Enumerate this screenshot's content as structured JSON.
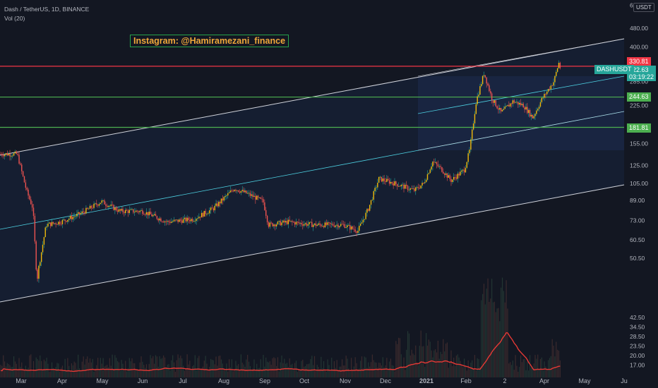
{
  "header": {
    "line1": "Dash / TetherUS, 1D, BINANCE",
    "line2": "Vol (20)"
  },
  "annotation": "Instagram: @Hamiramezani_finance",
  "unit_button": "USDT",
  "symbol_tag": "DASHUSDT",
  "price_tags": {
    "resistance": "330.81",
    "last": "322.63",
    "countdown": "03:19:22",
    "level_1": "244.63",
    "level_2": "181.81"
  },
  "colors": {
    "background": "#131722",
    "up": "#26a69a",
    "down": "#ef5350",
    "hline_red": "#f23645",
    "hline_green": "#4caf50",
    "channel": "#d1d4dc",
    "midline": "#2196f3",
    "volume_ma": "#e53935",
    "gold": "#f0b90b"
  },
  "chart_data": {
    "type": "candlestick",
    "title": "Dash / TetherUS, 1D, BINANCE",
    "y_scale": "log",
    "y_ticks": [
      "600.00",
      "480.00",
      "400.00",
      "340.00",
      "285.00",
      "225.00",
      "155.00",
      "125.00",
      "105.00",
      "89.00",
      "73.00",
      "60.50",
      "50.50",
      "42.50",
      "34.50",
      "28.50",
      "23.50",
      "20.00",
      "17.00"
    ],
    "x_ticks": [
      "Mar",
      "Apr",
      "May",
      "Jun",
      "Jul",
      "Aug",
      "Sep",
      "Oct",
      "Nov",
      "Dec",
      "2021",
      "Feb",
      "2",
      "Apr",
      "May",
      "Ju"
    ],
    "horizontal_levels": [
      {
        "price": 330.81,
        "color": "red"
      },
      {
        "price": 244.63,
        "color": "green"
      },
      {
        "price": 181.81,
        "color": "green"
      }
    ],
    "last_price": 322.63,
    "series": [
      {
        "name": "Price",
        "points": [
          [
            "Feb 27",
            140
          ],
          [
            "Mar 05",
            98
          ],
          [
            "Mar 10",
            82
          ],
          [
            "Mar 13",
            40
          ],
          [
            "Mar 14",
            45
          ],
          [
            "Mar 20",
            70
          ],
          [
            "Mar 31",
            72
          ],
          [
            "Apr 15",
            78
          ],
          [
            "May 01",
            88
          ],
          [
            "May 15",
            80
          ],
          [
            "Jun 01",
            80
          ],
          [
            "Jun 20",
            72
          ],
          [
            "Jul 10",
            74
          ],
          [
            "Jul 25",
            82
          ],
          [
            "Aug 10",
            100
          ],
          [
            "Aug 20",
            95
          ],
          [
            "Sep 01",
            88
          ],
          [
            "Sep 05",
            70
          ],
          [
            "Sep 20",
            72
          ],
          [
            "Oct 10",
            70
          ],
          [
            "Nov 01",
            70
          ],
          [
            "Nov 12",
            66
          ],
          [
            "Nov 20",
            82
          ],
          [
            "Nov 28",
            110
          ],
          [
            "Dec 10",
            105
          ],
          [
            "Dec 25",
            98
          ],
          [
            "Jan 01",
            105
          ],
          [
            "Jan 08",
            130
          ],
          [
            "Jan 15",
            120
          ],
          [
            "Jan 22",
            108
          ],
          [
            "Feb 01",
            120
          ],
          [
            "Feb 05",
            145
          ],
          [
            "Feb 10",
            235
          ],
          [
            "Feb 16",
            310
          ],
          [
            "Feb 22",
            240
          ],
          [
            "Mar 01",
            210
          ],
          [
            "Mar 10",
            235
          ],
          [
            "Mar 18",
            225
          ],
          [
            "Mar 25",
            200
          ],
          [
            "Apr 01",
            240
          ],
          [
            "Apr 10",
            285
          ],
          [
            "Apr 14",
            345
          ],
          [
            "Apr 15",
            322.63
          ]
        ]
      }
    ]
  }
}
